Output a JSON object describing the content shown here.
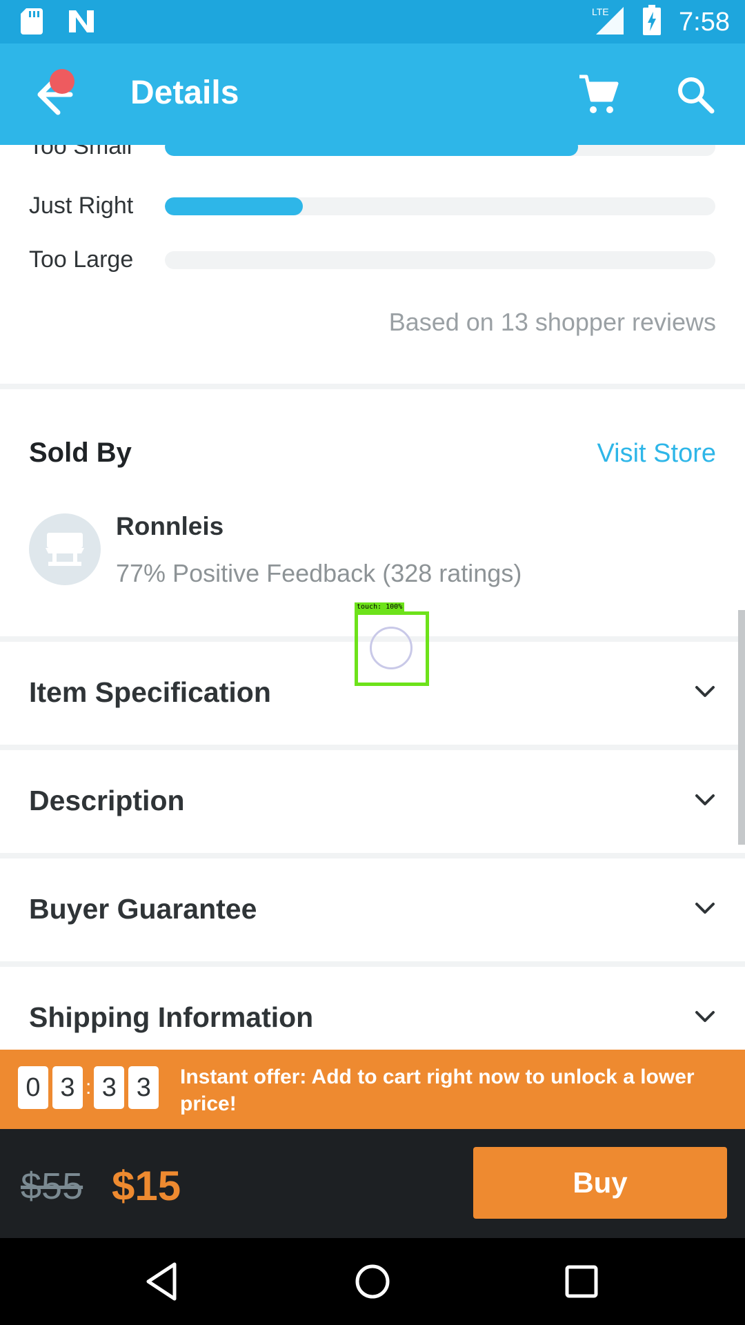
{
  "status_bar": {
    "time": "7:58",
    "network": "LTE"
  },
  "app_bar": {
    "title": "Details"
  },
  "fit": {
    "rows": [
      {
        "label": "Too Small",
        "fraction": 0.75
      },
      {
        "label": "Just Right",
        "fraction": 0.25
      },
      {
        "label": "Too Large",
        "fraction": 0.0
      }
    ],
    "based_on": "Based on 13 shopper reviews"
  },
  "sold_by": {
    "title": "Sold By",
    "visit_store": "Visit Store",
    "seller_name": "Ronnleis",
    "feedback": "77% Positive Feedback (328 ratings)"
  },
  "sections": [
    {
      "label": "Item Specification"
    },
    {
      "label": "Description"
    },
    {
      "label": "Buyer Guarantee"
    },
    {
      "label": "Shipping Information"
    }
  ],
  "touch_indicator": {
    "label": "touch: 100%"
  },
  "offer": {
    "countdown_digits": [
      "0",
      "3",
      "3",
      "3"
    ],
    "separator": ":",
    "text": "Instant offer: Add to cart right now to unlock a lower price!"
  },
  "purchase": {
    "old_price": "$55",
    "new_price": "$15",
    "buy_label": "Buy"
  },
  "colors": {
    "primary": "#2eb6e8",
    "status_bar": "#1ea6dd",
    "accent": "#ee8a30",
    "dark_bar": "#1d2023"
  },
  "icons": [
    "sd-card-icon",
    "n-logo-icon",
    "lte-signal-icon",
    "battery-charging-icon",
    "back-arrow-icon",
    "cart-icon",
    "search-icon",
    "store-icon",
    "chevron-down-icon",
    "back-triangle-icon",
    "home-circle-icon",
    "recents-square-icon"
  ]
}
